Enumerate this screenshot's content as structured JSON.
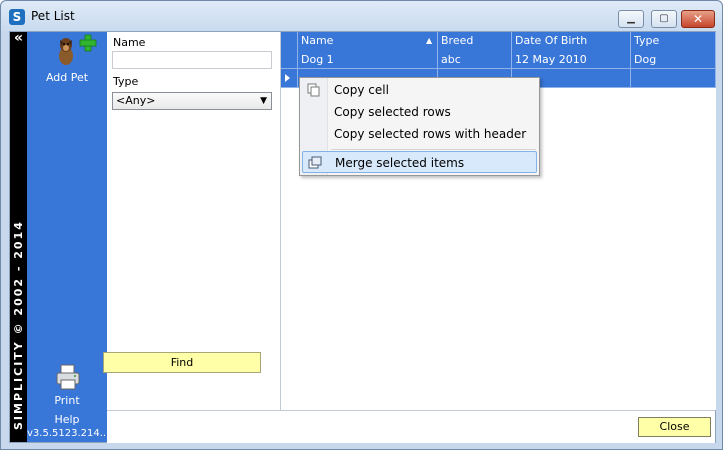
{
  "window": {
    "app_icon_letter": "S",
    "title": "Pet List",
    "min_icon": "minimize-icon",
    "max_icon": "maximize-icon",
    "close_icon": "close-icon"
  },
  "brand": {
    "text": "SIMPLICITY © 2002 - 2014",
    "collapse_glyph": "«"
  },
  "nav": {
    "add_pet_label": "Add Pet",
    "print_label": "Print",
    "help_label": "Help",
    "version": "v3.5.5123.214..."
  },
  "filter": {
    "name_label": "Name",
    "name_value": "",
    "type_label": "Type",
    "type_value": "<Any>",
    "find_label": "Find"
  },
  "grid": {
    "columns": [
      "Name",
      "Breed",
      "Date Of Birth",
      "Type"
    ],
    "rows": [
      [
        "Dog 1",
        "abc",
        "12 May 2010",
        "Dog"
      ],
      [
        "",
        "",
        "",
        ""
      ]
    ]
  },
  "context_menu": {
    "items": [
      {
        "label": "Copy cell",
        "icon": "copy-icon"
      },
      {
        "label": "Copy selected rows",
        "icon": ""
      },
      {
        "label": "Copy selected rows with header",
        "icon": ""
      },
      {
        "label": "Merge selected items",
        "icon": "merge-icon"
      }
    ]
  },
  "footer": {
    "close_label": "Close"
  },
  "colors": {
    "accent_blue": "#3876d8",
    "button_yellow": "#ffffa8",
    "brand_strip": "#000000"
  }
}
